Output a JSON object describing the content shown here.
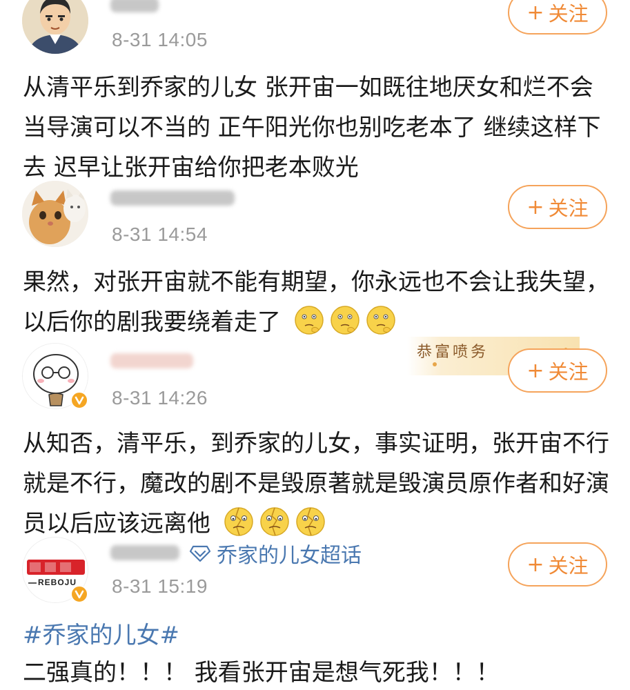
{
  "posts": [
    {
      "timestamp": "8-31 14:05",
      "follow_label": "关注",
      "text": "从清平乐到乔家的儿女 张开宙一如既往地厌女和烂不会当导演可以不当的 正午阳光你也别吃老本了 继续这样下去 迟早让张开宙给你把老本败光",
      "avatar_icon": "cartoon-man-avatar"
    },
    {
      "timestamp": "8-31 14:54",
      "follow_label": "关注",
      "text": "果然，对张开宙就不能有期望，你永远也不会让我失望，以后你的剧我要绕着走了",
      "emojis": [
        "thinking-emoji",
        "thinking-emoji",
        "thinking-emoji"
      ],
      "avatar_icon": "cat-photo-avatar"
    },
    {
      "timestamp": "8-31 14:26",
      "follow_label": "关注",
      "text": "从知否，清平乐，到乔家的儿女，事实证明，张开宙不行就是不行，魔改的剧不是毁原著就是毁演员原作者和好演员以后应该远离他",
      "emojis": [
        "broken-heart-face-emoji",
        "broken-heart-face-emoji",
        "broken-heart-face-emoji"
      ],
      "avatar_icon": "cartoon-glasses-avatar",
      "banner_text": "恭富喷务"
    },
    {
      "timestamp": "8-31 15:19",
      "follow_label": "关注",
      "topic": "乔家的儿女超话",
      "avatar_logo_text": "REBOJU",
      "hashtag": "#乔家的儿女#",
      "text": "二强真的！！！ 我看张开宙是想气死我！！！",
      "avatar_icon": "reboju-logo-avatar"
    }
  ],
  "colors": {
    "accent_orange": "#f08a36",
    "link_blue": "#4a78b0",
    "timestamp_gray": "#9a9a9a",
    "verified_badge": "#f5a623"
  }
}
